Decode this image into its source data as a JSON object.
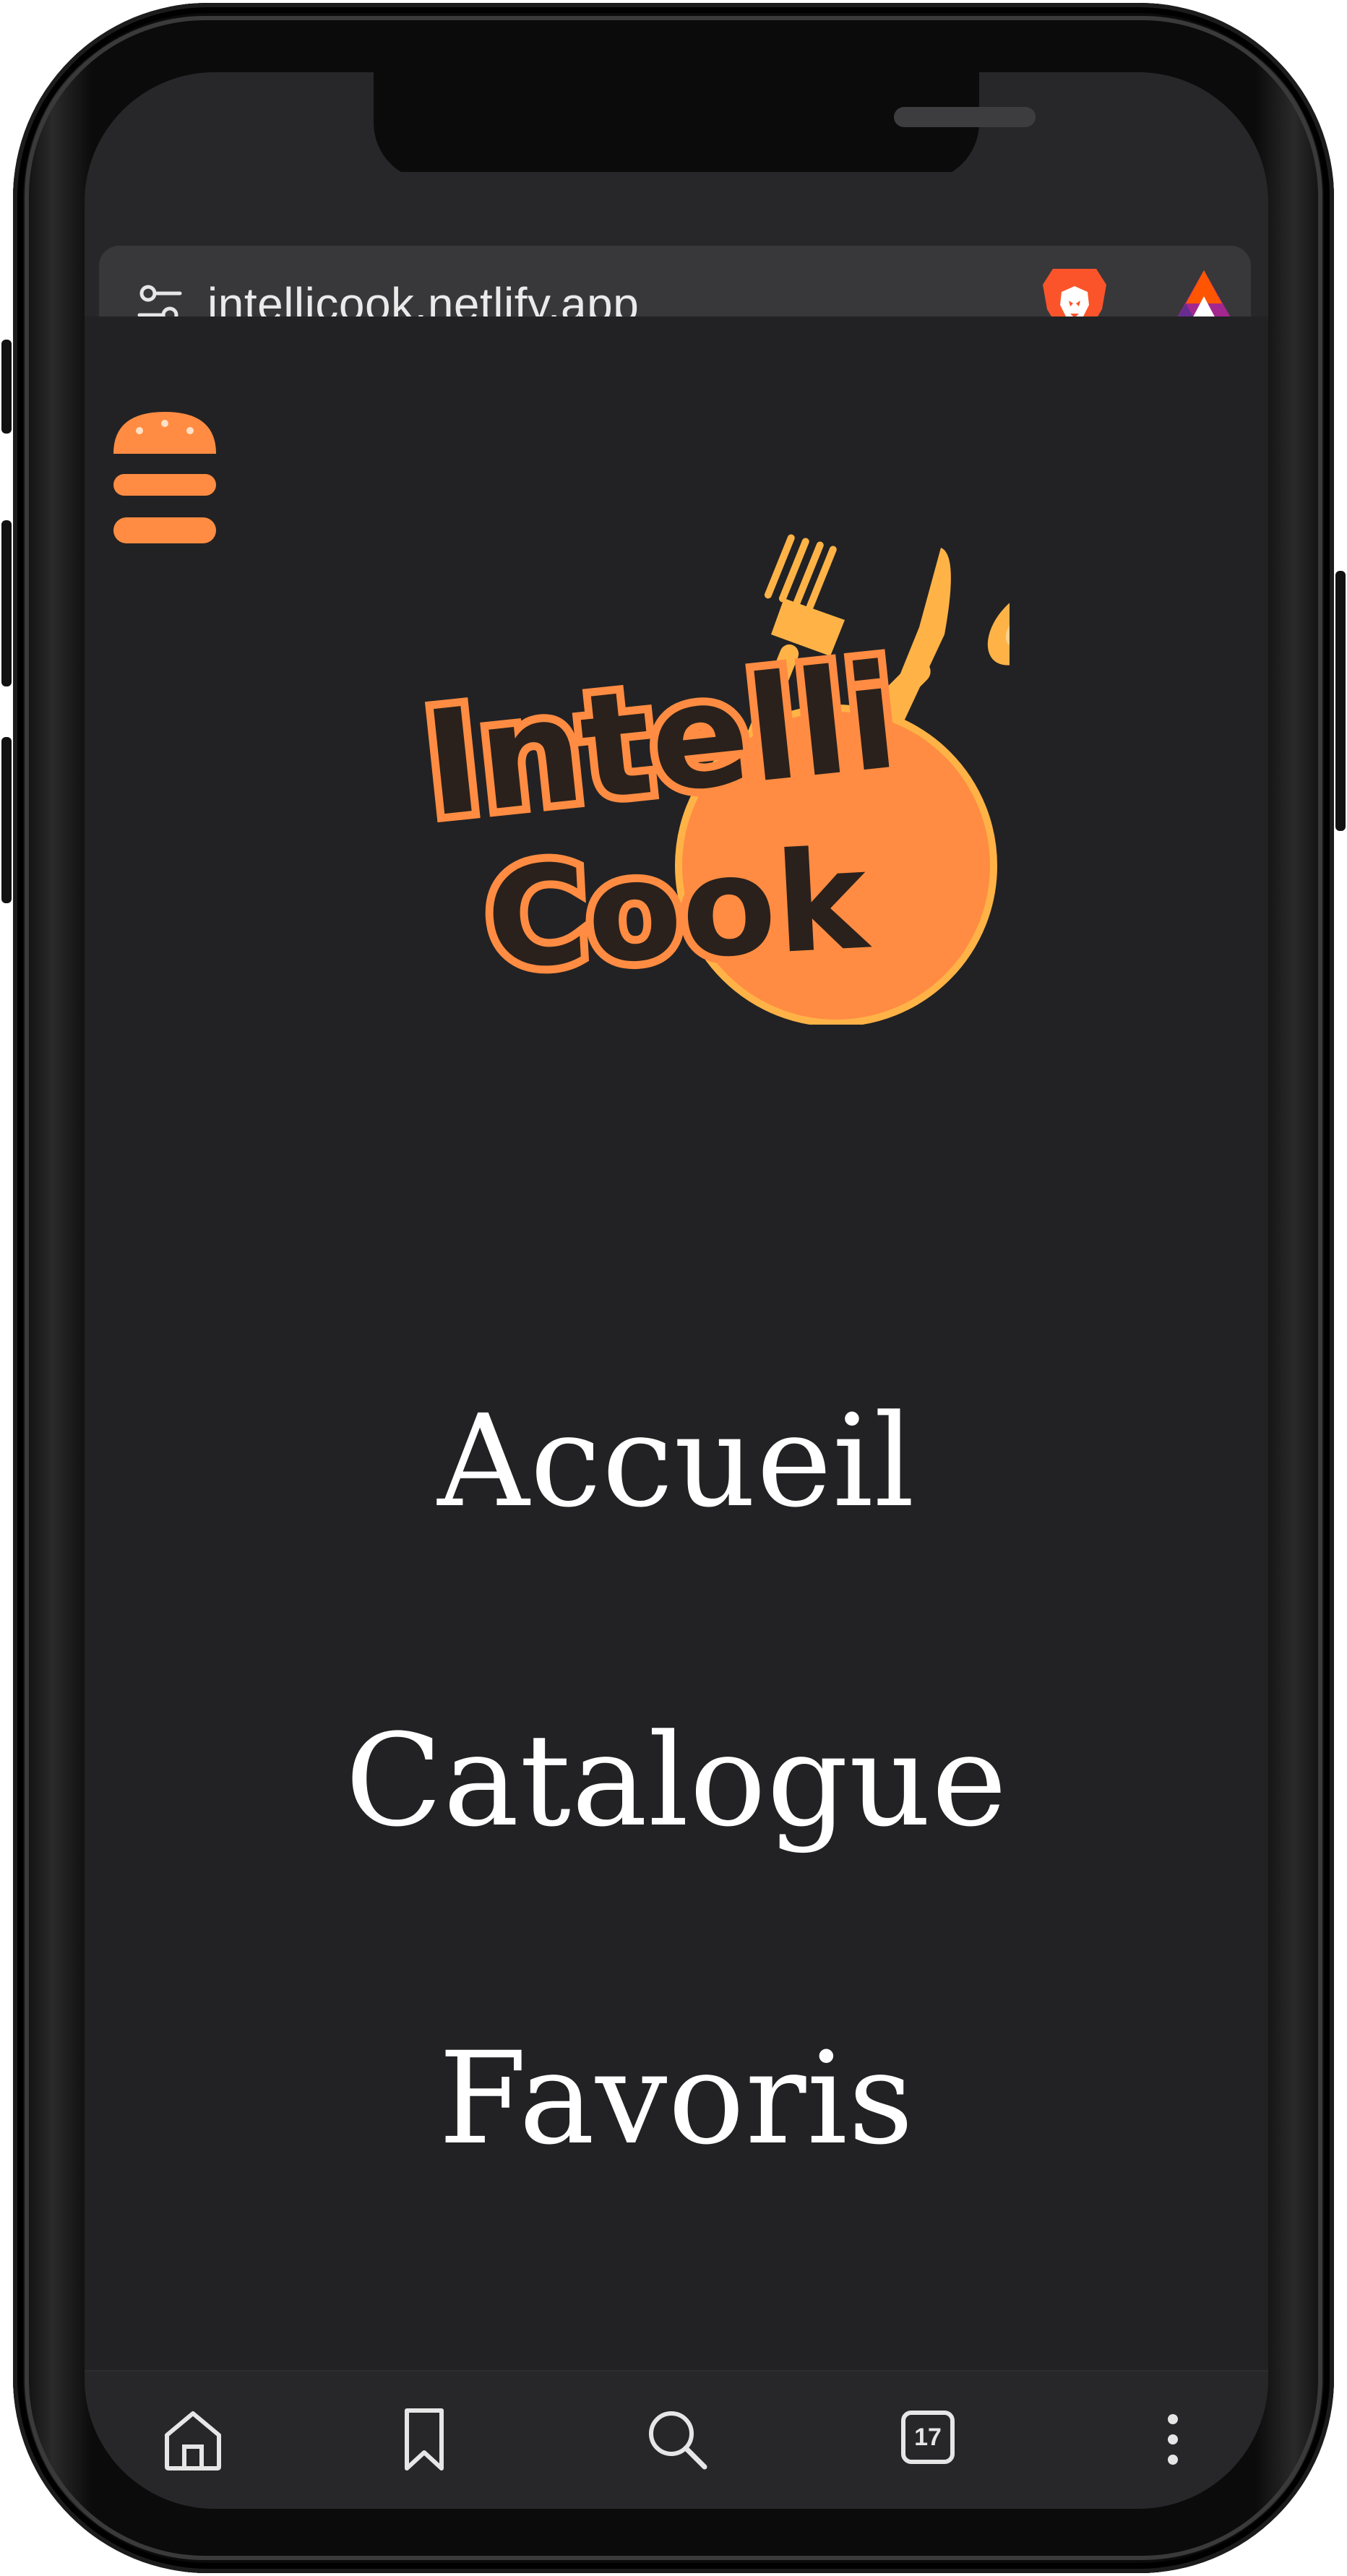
{
  "browser": {
    "url": "intellicook.netlify.app",
    "tabs_count": "17"
  },
  "logo": {
    "line1": "Intelli",
    "line2": "Cook"
  },
  "nav": {
    "items": [
      "Accueil",
      "Catalogue",
      "Favoris"
    ]
  },
  "colors": {
    "accent": "#ff8c42",
    "utensil": "#ffb347",
    "background": "#222224"
  },
  "icons": {
    "menu": "burger-menu-icon",
    "site_settings": "tune-icon",
    "brave": "brave-lion-icon",
    "rewards": "brave-rewards-icon",
    "home": "home-icon",
    "bookmark": "bookmark-icon",
    "search": "search-icon",
    "tabs": "tabs-counter-icon",
    "more": "more-vertical-icon"
  }
}
